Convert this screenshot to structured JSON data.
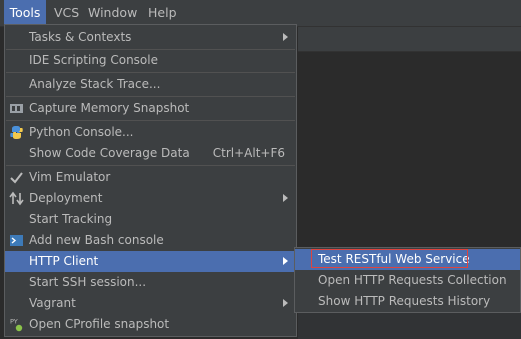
{
  "menubar": {
    "tools": "Tools",
    "vcs": "VCS",
    "window": "Window",
    "help": "Help"
  },
  "tools_menu": {
    "tasks_contexts": "Tasks & Contexts",
    "ide_scripting_console": "IDE Scripting Console",
    "analyze_stack_trace": "Analyze Stack Trace...",
    "capture_memory_snapshot": "Capture Memory Snapshot",
    "python_console": "Python Console...",
    "show_code_coverage_data": "Show Code Coverage Data",
    "show_code_coverage_shortcut": "Ctrl+Alt+F6",
    "vim_emulator": "Vim Emulator",
    "deployment": "Deployment",
    "start_tracking": "Start Tracking",
    "add_new_bash_console": "Add new Bash console",
    "http_client": "HTTP Client",
    "start_ssh_session": "Start SSH session...",
    "vagrant": "Vagrant",
    "open_cprofile_snapshot": "Open CProfile snapshot"
  },
  "http_client_submenu": {
    "test_restful_web_service": "Test RESTful Web Service",
    "open_http_requests_collection": "Open HTTP Requests Collection",
    "show_http_requests_history": "Show HTTP Requests History"
  },
  "colors": {
    "menu_bg": "#3c3f41",
    "highlight": "#4b6eaf",
    "text": "#bbbbbb",
    "annotation_box": "#e0443e"
  },
  "icons": [
    "checkmark-icon",
    "memory-snapshot-icon",
    "python-icon",
    "deployment-icon",
    "bash-console-icon",
    "cprofile-icon",
    "submenu-arrow-icon"
  ]
}
